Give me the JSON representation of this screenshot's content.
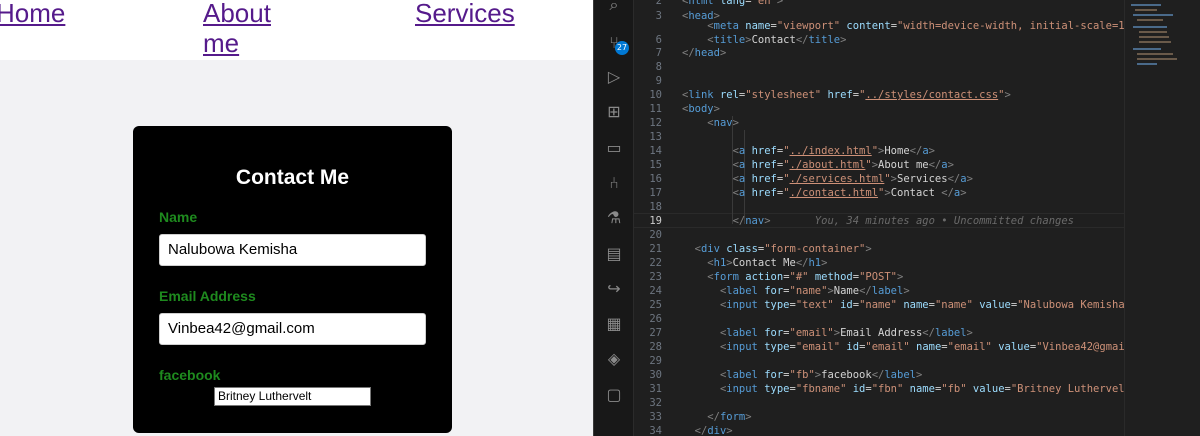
{
  "preview": {
    "nav": {
      "home": "Home",
      "about": "About me",
      "services": "Services"
    },
    "form": {
      "title": "Contact Me",
      "name_label": "Name",
      "name_value": "Nalubowa Kemisha",
      "email_label": "Email Address",
      "email_value": "Vinbea42@gmail.com",
      "facebook_label": "facebook",
      "facebook_value": "Britney Luthervelt"
    }
  },
  "editor": {
    "scm_badge": "27",
    "activity_icons": [
      "search-icon",
      "source-control-icon",
      "run-debug-icon",
      "extensions-icon",
      "remote-explorer-icon",
      "git-graph-icon",
      "testing-icon",
      "folder-icon",
      "live-share-icon",
      "docker-icon",
      "python-icon",
      "comments-icon"
    ],
    "current_line": 19,
    "blame": "You, 34 minutes ago • Uncommitted changes"
  }
}
